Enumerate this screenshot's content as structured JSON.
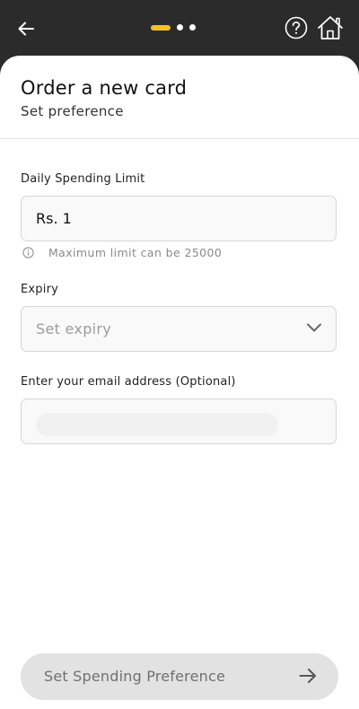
{
  "stepper": {
    "current_step": 1,
    "total_steps": 3
  },
  "page": {
    "title": "Order a new card",
    "subtitle": "Set preference"
  },
  "form": {
    "spending_limit": {
      "label": "Daily Spending Limit",
      "value": "Rs. 1",
      "hint": "Maximum limit can be 25000"
    },
    "expiry": {
      "label": "Expiry",
      "placeholder": "Set expiry"
    },
    "email": {
      "label": "Enter your email address (Optional)",
      "value": ""
    }
  },
  "cta": {
    "label": "Set Spending Preference"
  },
  "colors": {
    "topbar_bg": "#2b2b2b",
    "step_active": "#f5c024",
    "cta_bg": "#e2e2e2",
    "cta_text": "#707070"
  },
  "icons": {
    "back": "arrow-left-icon",
    "help": "question-circle-icon",
    "home": "home-icon",
    "info": "info-icon",
    "dropdown": "chevron-down-icon",
    "cta_arrow": "arrow-right-icon"
  }
}
